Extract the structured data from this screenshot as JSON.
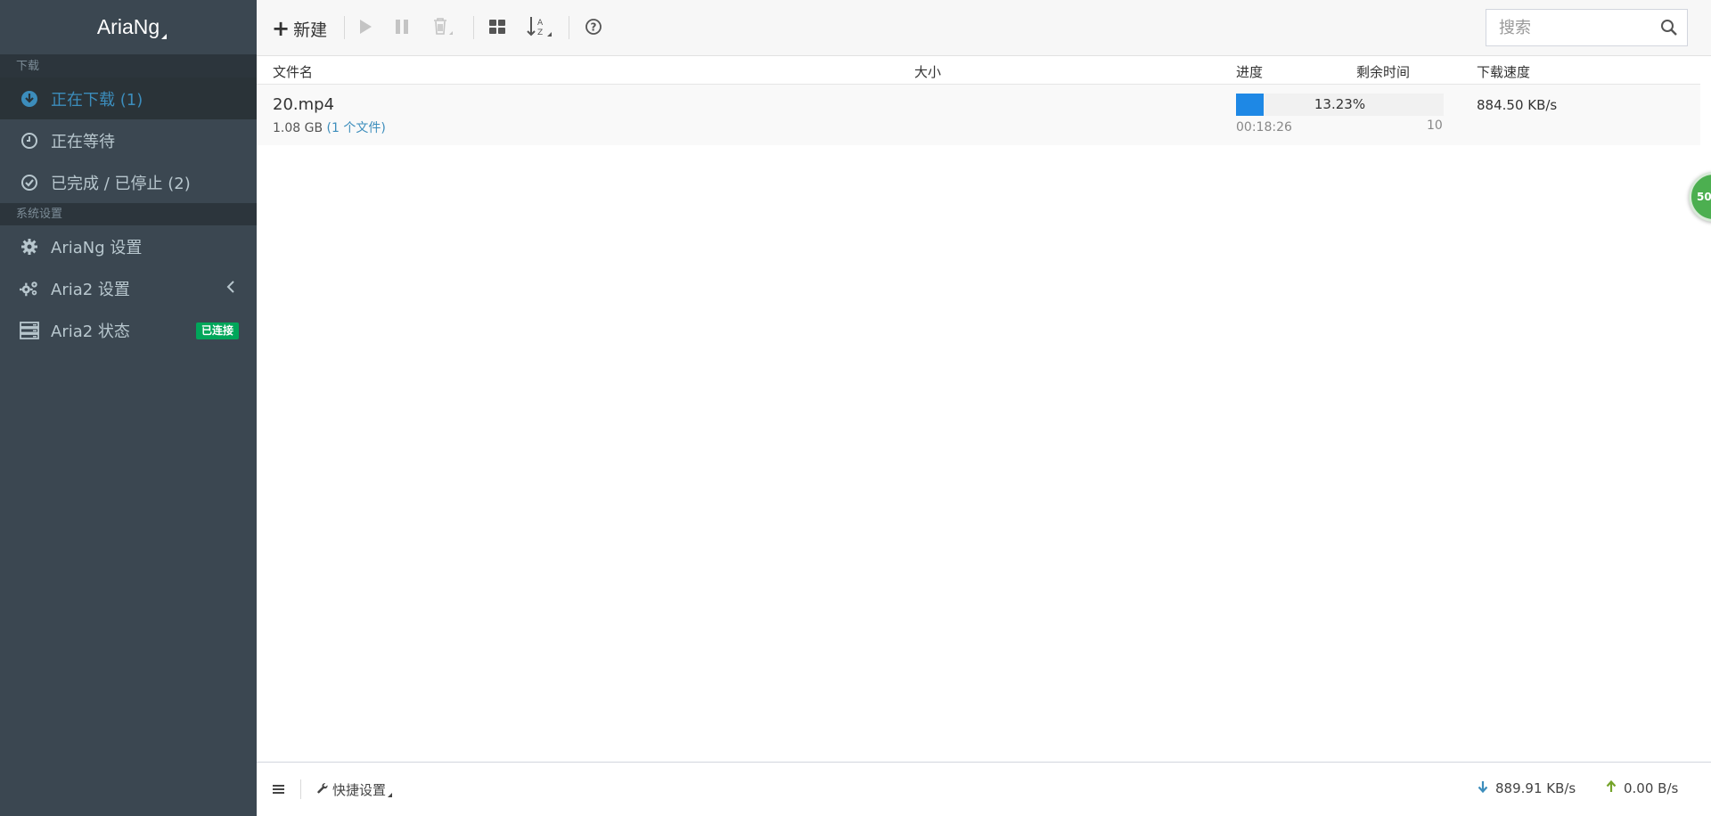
{
  "brand": {
    "title": "AriaNg"
  },
  "sidebar": {
    "sections": [
      {
        "header": "下载"
      },
      {
        "header": "系统设置"
      }
    ],
    "items": [
      {
        "label": "正在下载 (1)",
        "icon": "download-circle-icon"
      },
      {
        "label": "正在等待",
        "icon": "clock-icon"
      },
      {
        "label": "已完成 / 已停止 (2)",
        "icon": "check-circle-icon"
      },
      {
        "label": "AriaNg 设置",
        "icon": "gear-icon"
      },
      {
        "label": "Aria2 设置",
        "icon": "gears-icon"
      },
      {
        "label": "Aria2 状态",
        "icon": "server-icon",
        "badge": "已连接"
      }
    ]
  },
  "toolbar": {
    "new_label": "新建",
    "search_placeholder": "搜索"
  },
  "table": {
    "headers": {
      "name": "文件名",
      "size": "大小",
      "progress": "进度",
      "remaining": "剩余时间",
      "speed": "下载速度"
    },
    "rows": [
      {
        "name": "20.mp4",
        "size": "1.08 GB",
        "files": "(1 个文件)",
        "progress_text": "13.23%",
        "progress_value": 13.23,
        "remaining": "00:18:26",
        "connections": "10",
        "speed": "884.50 KB/s"
      }
    ]
  },
  "floating": {
    "label": "50"
  },
  "footer": {
    "quick_settings": "快捷设置",
    "download_speed": "889.91 KB/s",
    "upload_speed": "0.00 B/s"
  },
  "colors": {
    "sidebar_bg": "#3b4751",
    "accent": "#3c8dbc",
    "progress": "#1e88e5",
    "badge": "#00a65a"
  }
}
